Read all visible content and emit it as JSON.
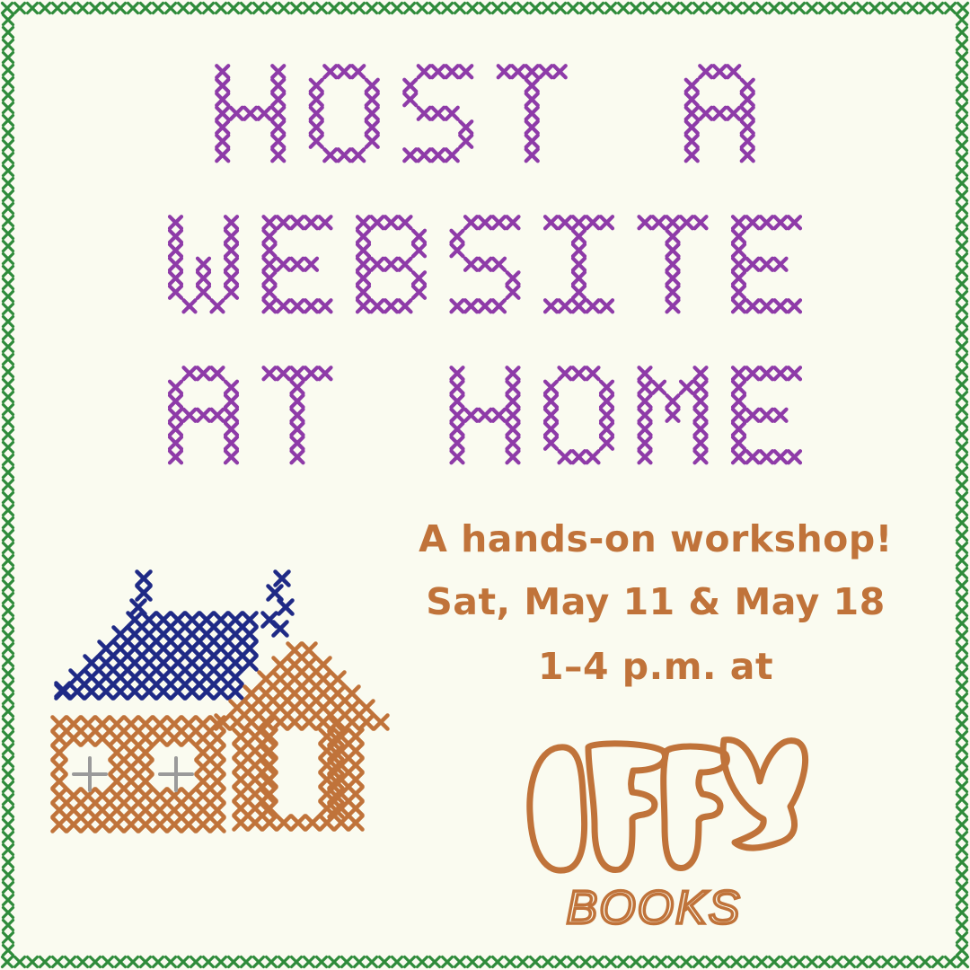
{
  "headline": {
    "lines": [
      "HOST A",
      "WEBSITE",
      "AT HOME"
    ]
  },
  "details": {
    "line1": "A hands-on workshop!",
    "line2": "Sat, May 11 & May 18",
    "line3": "1–4 p.m. at"
  },
  "venue": {
    "logo_text": "IFFY",
    "sub_text": "BOOKS"
  },
  "colors": {
    "background": "#fafbf0",
    "border": "#2e8b3a",
    "headline": "#8e3ba8",
    "details": "#c0733a",
    "roof": "#1f2a86",
    "house": "#c0733a",
    "window_cross": "#9a9a9a"
  },
  "illustration": "cross-stitch-house-icon"
}
